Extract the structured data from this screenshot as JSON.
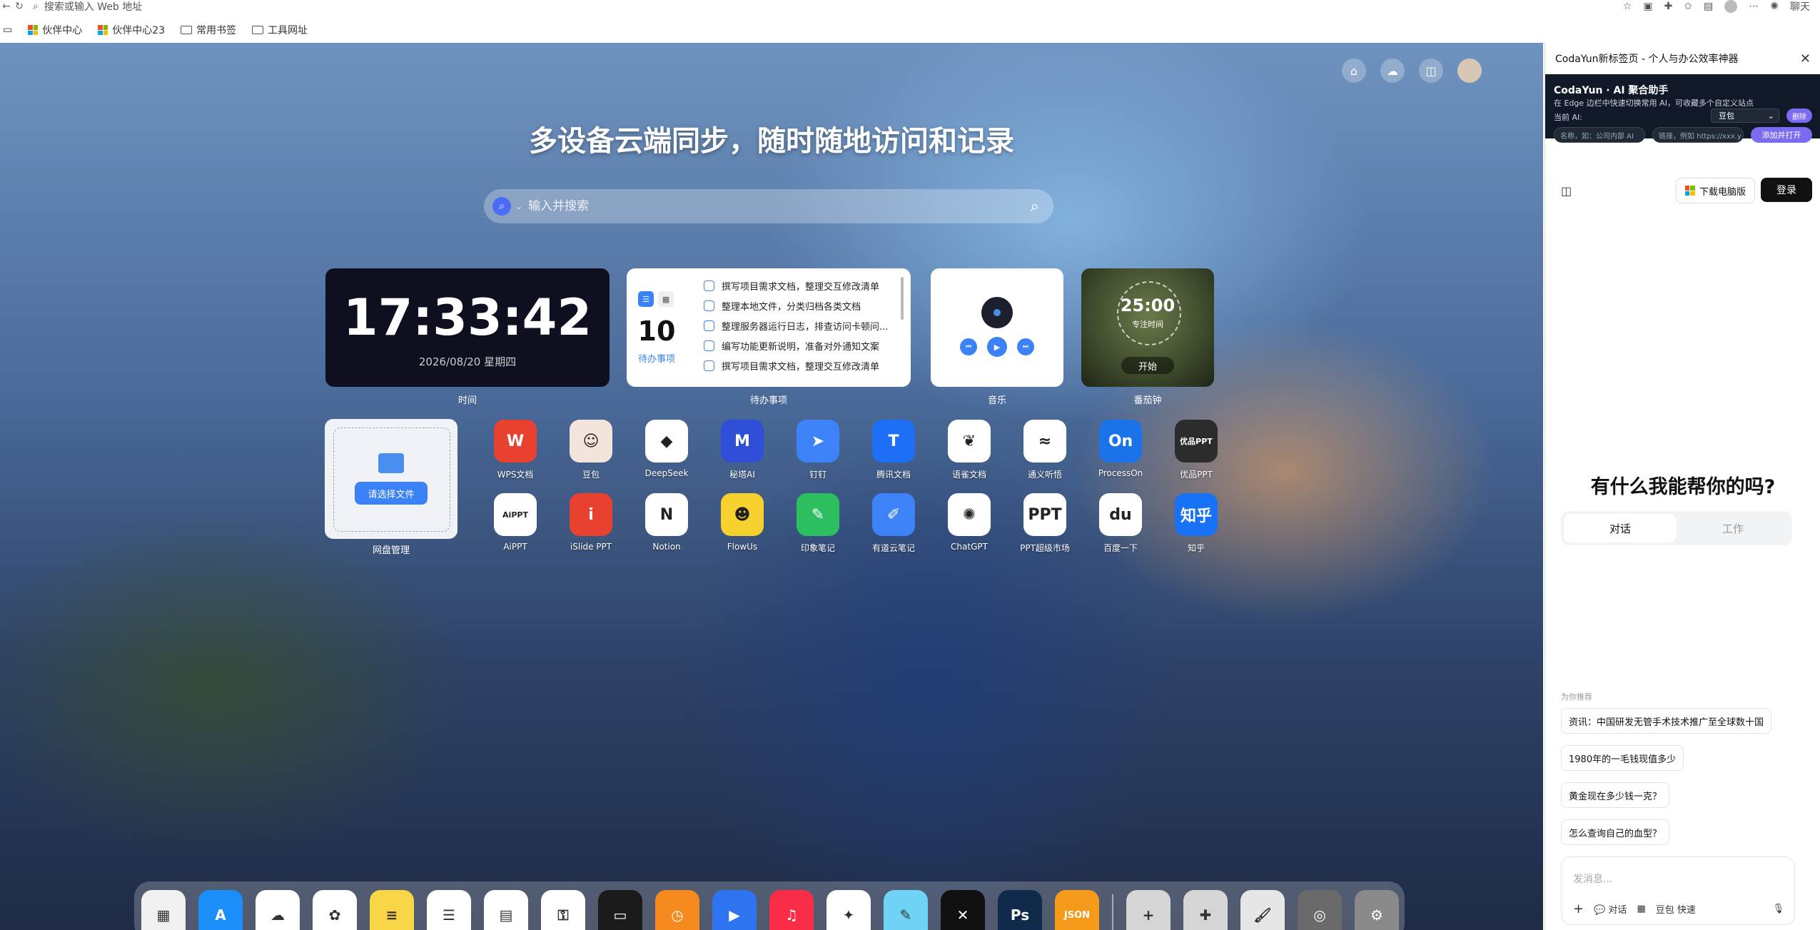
{
  "browser": {
    "address_placeholder": "搜索或输入 Web 地址",
    "profile_label": "聊天",
    "bookmarks": [
      {
        "label": "伙伴中心",
        "icon": "microsoft-icon"
      },
      {
        "label": "伙伴中心23",
        "icon": "microsoft-icon"
      },
      {
        "label": "常用书签",
        "icon": "folder-icon"
      },
      {
        "label": "工具网址",
        "icon": "folder-icon"
      }
    ]
  },
  "newtab": {
    "headline": "多设备云端同步，随时随地访问和记录",
    "search_placeholder": "输入并搜索",
    "clock": {
      "time": "17:33:42",
      "date": "2026/08/20 星期四",
      "label": "时间"
    },
    "todo": {
      "count": "10",
      "count_label": "待办事项",
      "label": "待办事项",
      "items": [
        "撰写项目需求文档，整理交互修改清单",
        "整理本地文件，分类归档各类文档",
        "整理服务器运行日志，排查访问卡顿问...",
        "编写功能更新说明，准备对外通知文案",
        "撰写项目需求文档，整理交互修改清单"
      ]
    },
    "music": {
      "label": "音乐"
    },
    "pomodoro": {
      "time": "25:00",
      "sub": "专注时间",
      "start": "开始",
      "label": "番茄钟"
    },
    "disk": {
      "button": "请选择文件",
      "label": "网盘管理"
    },
    "apps": [
      {
        "name": "WPS文档",
        "icon": "W",
        "color": "#e8412f"
      },
      {
        "name": "豆包",
        "icon": "☺",
        "color": "#f3e4dc"
      },
      {
        "name": "DeepSeek",
        "icon": "◆",
        "color": "#ffffff"
      },
      {
        "name": "秘塔AI",
        "icon": "M",
        "color": "#2f4fd8"
      },
      {
        "name": "钉钉",
        "icon": "➤",
        "color": "#3d82f7"
      },
      {
        "name": "腾讯文档",
        "icon": "T",
        "color": "#1e6ff5"
      },
      {
        "name": "语雀文档",
        "icon": "❦",
        "color": "#ffffff"
      },
      {
        "name": "通义听悟",
        "icon": "≈",
        "color": "#ffffff"
      },
      {
        "name": "ProcessOn",
        "icon": "On",
        "color": "#1a73e8"
      },
      {
        "name": "优品PPT",
        "icon": "优品PPT",
        "color": "#2c2c2c"
      },
      {
        "name": "AiPPT",
        "icon": "AiPPT",
        "color": "#ffffff"
      },
      {
        "name": "iSlide PPT",
        "icon": "i",
        "color": "#e8412f"
      },
      {
        "name": "Notion",
        "icon": "N",
        "color": "#ffffff"
      },
      {
        "name": "FlowUs",
        "icon": "☻",
        "color": "#f7d12e"
      },
      {
        "name": "印象笔记",
        "icon": "✎",
        "color": "#2dbe60"
      },
      {
        "name": "有道云笔记",
        "icon": "✐",
        "color": "#3d82f7"
      },
      {
        "name": "ChatGPT",
        "icon": "✺",
        "color": "#ffffff"
      },
      {
        "name": "PPT超级市场",
        "icon": "PPT",
        "color": "#ffffff"
      },
      {
        "name": "百度一下",
        "icon": "du",
        "color": "#ffffff"
      },
      {
        "name": "知乎",
        "icon": "知乎",
        "color": "#1772f6"
      }
    ],
    "dock": [
      {
        "icon": "launchpad-icon",
        "color": "#f0f0f0",
        "glyph": "▦"
      },
      {
        "icon": "app-store-icon",
        "color": "#1c8ef9",
        "glyph": "A"
      },
      {
        "icon": "icloud-icon",
        "color": "#ffffff",
        "glyph": "☁"
      },
      {
        "icon": "photos-icon",
        "color": "#ffffff",
        "glyph": "✿"
      },
      {
        "icon": "notes-icon",
        "color": "#f9d548",
        "glyph": "≡"
      },
      {
        "icon": "reminders-icon",
        "color": "#ffffff",
        "glyph": "☰"
      },
      {
        "icon": "calendar-icon",
        "color": "#ffffff",
        "glyph": "▤"
      },
      {
        "icon": "passwords-icon",
        "color": "#ffffff",
        "glyph": "⚿"
      },
      {
        "icon": "wallet-icon",
        "color": "#1b1b1b",
        "glyph": "▭"
      },
      {
        "icon": "clock-icon",
        "color": "#f58a1f",
        "glyph": "◷"
      },
      {
        "icon": "play-icon",
        "color": "#2e73f0",
        "glyph": "▶"
      },
      {
        "icon": "music-icon",
        "color": "#fa2d48",
        "glyph": "♫"
      },
      {
        "icon": "safari-icon",
        "color": "#ffffff",
        "glyph": "✦"
      },
      {
        "icon": "freeform-icon",
        "color": "#6fd3f5",
        "glyph": "✎"
      },
      {
        "icon": "cross-icon",
        "color": "#111111",
        "glyph": "✕"
      },
      {
        "icon": "photoshop-icon",
        "color": "#0f2a4a",
        "glyph": "Ps"
      },
      {
        "icon": "json-icon",
        "color": "#f59a1b",
        "glyph": "JSON"
      },
      {
        "icon": "add-icon",
        "color": "#d5d5d5",
        "glyph": "+"
      },
      {
        "icon": "puzzle-icon",
        "color": "#d5d5d5",
        "glyph": "✚"
      },
      {
        "icon": "brush-icon",
        "color": "#e6e6e6",
        "glyph": "🖌"
      },
      {
        "icon": "camera-icon",
        "color": "#6a6a6a",
        "glyph": "◎"
      },
      {
        "icon": "settings-icon",
        "color": "#8a8a8a",
        "glyph": "⚙"
      }
    ]
  },
  "sidepanel": {
    "title": "CodaYun新标签页 - 个人与办公效率神器",
    "agg_title": "CodaYun · AI 聚合助手",
    "agg_desc": "在 Edge 边栏中快速切换常用 AI，可收藏多个自定义站点",
    "current_ai_label": "当前 AI:",
    "current_ai": "豆包",
    "delete": "删除",
    "name_placeholder": "名称，如：公司内部 AI",
    "url_placeholder": "链接，例如 https://xxx.y",
    "add_open": "添加并打开",
    "download": "下载电脑版",
    "login": "登录",
    "question": "有什么我能帮你的吗?",
    "tab_chat": "对话",
    "tab_work": "工作",
    "recommend": "为你推荐",
    "suggestions": [
      "资讯：中国研发无管手术技术推广至全球数十国",
      "1980年的一毛钱现值多少",
      "黄金现在多少钱一克？",
      "怎么查询自己的血型？"
    ],
    "compose_placeholder": "发消息...",
    "compose_chat": "对话",
    "compose_quick": "豆包 快速"
  }
}
